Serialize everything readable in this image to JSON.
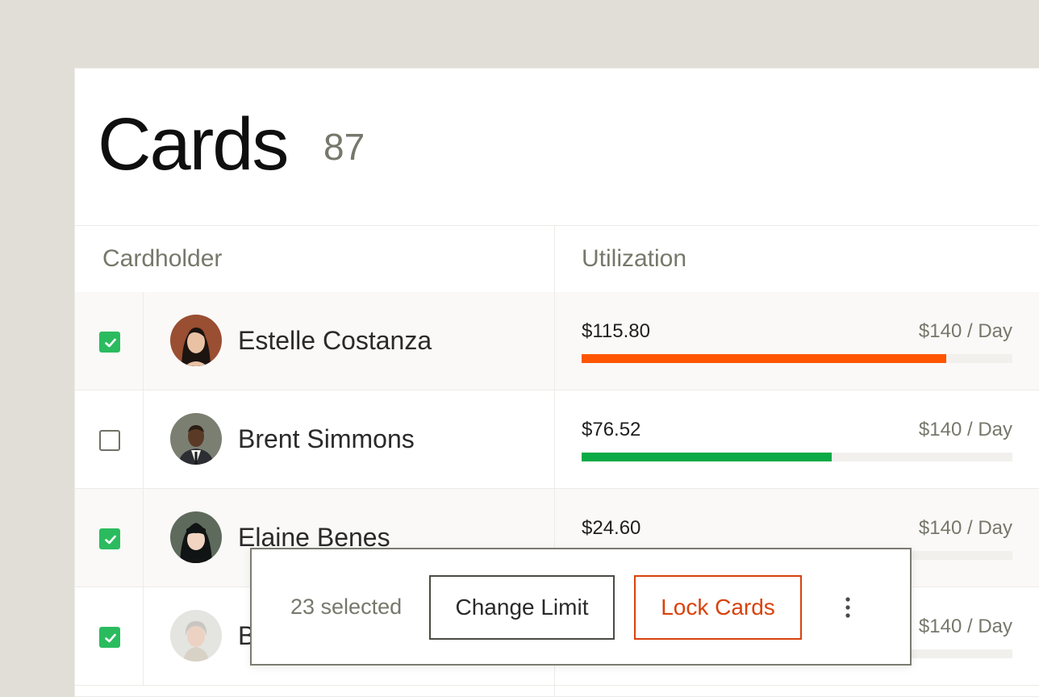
{
  "page": {
    "title": "Cards",
    "count": "87"
  },
  "table": {
    "columns": {
      "cardholder": "Cardholder",
      "utilization": "Utilization"
    },
    "rows": [
      {
        "name": "Estelle Costanza",
        "checked": true,
        "amount": "$115.80",
        "limit": "$140 / Day",
        "utilization_fraction": 0.847,
        "bar_color": "#ff5500",
        "avatar": "woman-dark-hair-avatar"
      },
      {
        "name": "Brent Simmons",
        "checked": false,
        "amount": "$76.52",
        "limit": "$140 / Day",
        "utilization_fraction": 0.58,
        "bar_color": "#0aaa47",
        "avatar": "man-suit-avatar"
      },
      {
        "name": "Elaine Benes",
        "checked": true,
        "amount": "$24.60",
        "limit": "$140 / Day",
        "utilization_fraction": 0.176,
        "bar_color": "#0aaa47",
        "avatar": "woman-bangs-avatar"
      },
      {
        "name": "B",
        "checked": true,
        "amount": "",
        "limit": "$140 / Day",
        "utilization_fraction": null,
        "bar_color": "#0aaa47",
        "avatar": "woman-gray-hair-avatar"
      }
    ]
  },
  "action_bar": {
    "selected_text": "23 selected",
    "change_limit_label": "Change Limit",
    "lock_cards_label": "Lock Cards"
  },
  "colors": {
    "check_green": "#2bbb5f",
    "accent_orange": "#d9420c",
    "background": "#e1ded8"
  }
}
